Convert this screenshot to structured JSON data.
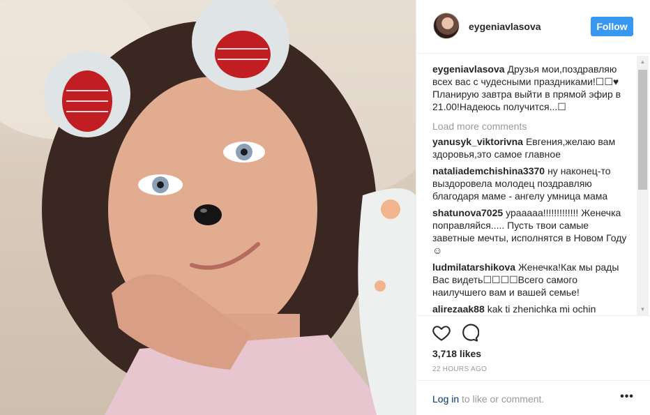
{
  "post": {
    "username": "eygeniavlasova",
    "follow_label": "Follow",
    "caption": {
      "user": "eygeniavlasova",
      "text": "Друзья мои,поздравляю всех вас с чудесными праздниками!☐☐♥ Планирую завтра выйти в прямой эфир в 21.00!Надеюсь получится...☐"
    },
    "load_more_label": "Load more comments",
    "comments": [
      {
        "user": "yanusyk_viktorivna",
        "text": "Евгения,желаю вам здоровья,это самое главное"
      },
      {
        "user": "nataliademchishina3370",
        "text": "ну наконец-то выздоровела молодец поздравляю благодаря маме - ангелу умница мама"
      },
      {
        "user": "shatunova7025",
        "text": "урааааа!!!!!!!!!!!!! Женечка поправляйся..... Пусть твои самые заветные мечты, исполнятся в Новом Году☺"
      },
      {
        "user": "ludmilatarshikova",
        "text": "Женечка!Как мы рады Вас видеть☐☐☐☐Всего самого наилучшего вам и вашей семье!"
      },
      {
        "user": "alirezaak88",
        "text": "kak ti zhenichka mi ochin"
      }
    ],
    "likes": "3,718 likes",
    "timestamp": "22 HOURS AGO",
    "login_link": "Log in",
    "login_rest": " to like or comment.",
    "more_label": "•••",
    "icons": {
      "heart": "heart-icon",
      "comment": "speech-bubble-icon",
      "more": "ellipsis-icon"
    },
    "colors": {
      "follow_bg": "#3897f0",
      "link": "#003569",
      "muted": "#999999"
    }
  }
}
